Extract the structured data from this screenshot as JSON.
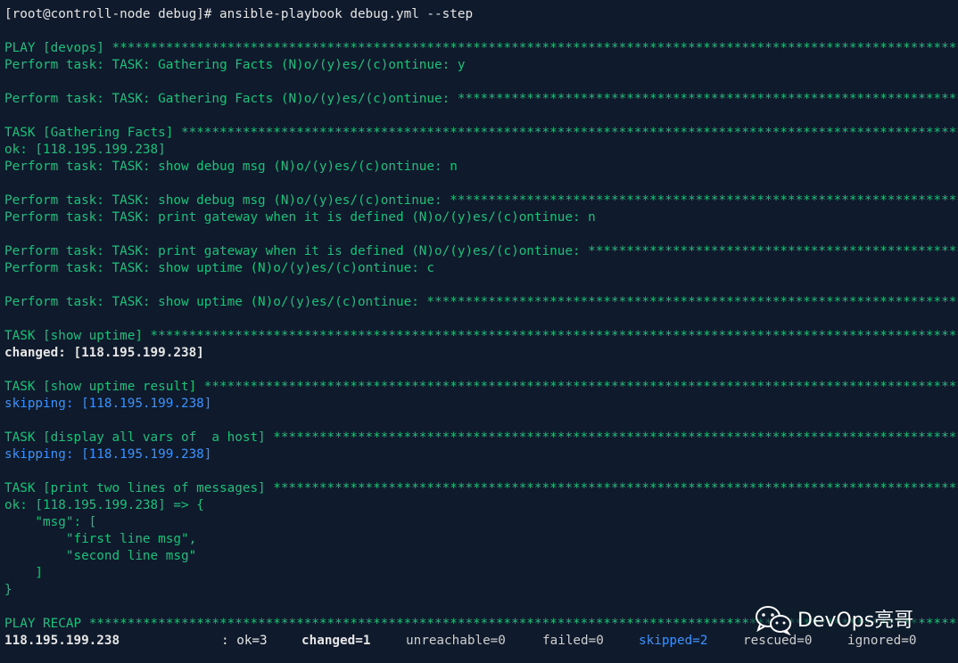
{
  "terminal": {
    "lines": [
      {
        "parts": [
          {
            "t": "[root@controll-node debug]# ansible-playbook debug.yml --step",
            "c": "white"
          }
        ]
      },
      {
        "parts": []
      },
      {
        "parts": [
          {
            "t": "PLAY [devops] ",
            "c": "green"
          },
          {
            "t": "stars",
            "c": "stars"
          }
        ]
      },
      {
        "parts": [
          {
            "t": "Perform task: TASK: Gathering Facts (N)o/(y)es/(c)ontinue: y",
            "c": "green"
          }
        ]
      },
      {
        "parts": []
      },
      {
        "parts": [
          {
            "t": "Perform task: TASK: Gathering Facts (N)o/(y)es/(c)ontinue: ",
            "c": "green"
          },
          {
            "t": "stars",
            "c": "stars"
          }
        ]
      },
      {
        "parts": []
      },
      {
        "parts": [
          {
            "t": "TASK [Gathering Facts] ",
            "c": "green"
          },
          {
            "t": "stars",
            "c": "stars"
          }
        ]
      },
      {
        "parts": [
          {
            "t": "ok: [118.195.199.238]",
            "c": "green"
          }
        ]
      },
      {
        "parts": [
          {
            "t": "Perform task: TASK: show debug msg (N)o/(y)es/(c)ontinue: n",
            "c": "green"
          }
        ]
      },
      {
        "parts": []
      },
      {
        "parts": [
          {
            "t": "Perform task: TASK: show debug msg (N)o/(y)es/(c)ontinue: ",
            "c": "green"
          },
          {
            "t": "stars",
            "c": "stars"
          }
        ]
      },
      {
        "parts": [
          {
            "t": "Perform task: TASK: print gateway when it is defined (N)o/(y)es/(c)ontinue: n",
            "c": "green"
          }
        ]
      },
      {
        "parts": []
      },
      {
        "parts": [
          {
            "t": "Perform task: TASK: print gateway when it is defined (N)o/(y)es/(c)ontinue: ",
            "c": "green"
          },
          {
            "t": "stars",
            "c": "stars"
          }
        ]
      },
      {
        "parts": [
          {
            "t": "Perform task: TASK: show uptime (N)o/(y)es/(c)ontinue: c",
            "c": "green"
          }
        ]
      },
      {
        "parts": []
      },
      {
        "parts": [
          {
            "t": "Perform task: TASK: show uptime (N)o/(y)es/(c)ontinue: ",
            "c": "green"
          },
          {
            "t": "stars",
            "c": "stars"
          }
        ]
      },
      {
        "parts": []
      },
      {
        "parts": [
          {
            "t": "TASK [show uptime] ",
            "c": "green"
          },
          {
            "t": "stars",
            "c": "stars"
          }
        ]
      },
      {
        "parts": [
          {
            "t": "changed: [118.195.199.238]",
            "c": "white bold"
          }
        ]
      },
      {
        "parts": []
      },
      {
        "parts": [
          {
            "t": "TASK [show uptime result] ",
            "c": "green"
          },
          {
            "t": "stars",
            "c": "stars"
          }
        ]
      },
      {
        "parts": [
          {
            "t": "skipping: [118.195.199.238]",
            "c": "blue"
          }
        ]
      },
      {
        "parts": []
      },
      {
        "parts": [
          {
            "t": "TASK [display all vars of  a host] ",
            "c": "green"
          },
          {
            "t": "stars",
            "c": "stars"
          }
        ]
      },
      {
        "parts": [
          {
            "t": "skipping: [118.195.199.238]",
            "c": "blue"
          }
        ]
      },
      {
        "parts": []
      },
      {
        "parts": [
          {
            "t": "TASK [print two lines of messages] ",
            "c": "green"
          },
          {
            "t": "stars",
            "c": "stars"
          }
        ]
      },
      {
        "parts": [
          {
            "t": "ok: [118.195.199.238] => {",
            "c": "green"
          }
        ]
      },
      {
        "parts": [
          {
            "t": "    \"msg\": [",
            "c": "green"
          }
        ]
      },
      {
        "parts": [
          {
            "t": "        \"first line msg\",",
            "c": "green"
          }
        ]
      },
      {
        "parts": [
          {
            "t": "        \"second line msg\"",
            "c": "green"
          }
        ]
      },
      {
        "parts": [
          {
            "t": "    ]",
            "c": "green"
          }
        ]
      },
      {
        "parts": [
          {
            "t": "}",
            "c": "green"
          }
        ]
      },
      {
        "parts": []
      },
      {
        "parts": [
          {
            "t": "PLAY RECAP ",
            "c": "green"
          },
          {
            "t": "stars",
            "c": "stars"
          }
        ]
      }
    ],
    "recap": {
      "host": "118.195.199.238",
      "ok": ": ok=3",
      "changed": "changed=1",
      "unreachable": "unreachable=0",
      "failed": "failed=0",
      "skipped": "skipped=2",
      "rescued": "rescued=0",
      "ignored": "ignored=0"
    }
  },
  "watermark": {
    "text": "DevOps亮哥",
    "icon": "wechat-icon"
  },
  "colors": {
    "background": "#0f1b2c",
    "green": "#1fbf7a",
    "blue": "#3a92ff",
    "white": "#e6e6e6"
  }
}
